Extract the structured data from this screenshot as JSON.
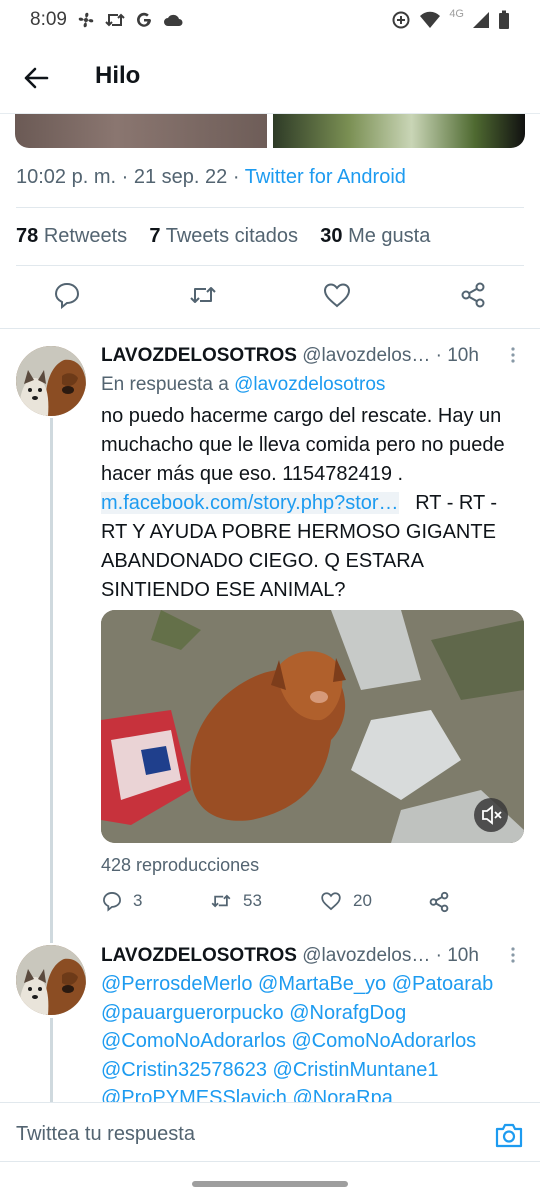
{
  "status_bar": {
    "time": "8:09",
    "network": "4G"
  },
  "header": {
    "title": "Hilo"
  },
  "main_tweet": {
    "time": "10:02 p. m.",
    "date": "21 sep. 22",
    "source": "Twitter for Android",
    "separator": "·",
    "retweets_count": "78",
    "retweets_label": "Retweets",
    "quotes_count": "7",
    "quotes_label": "Tweets citados",
    "likes_count": "30",
    "likes_label": "Me gusta"
  },
  "reply1": {
    "name": "LAVOZDELOSOTROS",
    "handle": "@lavozdelos…",
    "time": "· 10h",
    "reply_prefix": "En respuesta a",
    "reply_to": "@lavozdelosotros",
    "text_1": "no puedo hacerme cargo del rescate. Hay un muchacho que le lleva comida pero no puede hacer más que eso. 1154782419 .",
    "link": "m.facebook.com/story.php?stor…",
    "text_2": "RT - RT - RT Y AYUDA POBRE HERMOSO GIGANTE ABANDONADO CIEGO.    Q ESTARA SINTIENDO ESE ANIMAL?",
    "views": "428 reproducciones",
    "replies": "3",
    "retweets": "53",
    "likes": "20"
  },
  "reply2": {
    "name": "LAVOZDELOSOTROS",
    "handle": "@lavozdelos…",
    "time": "· 10h",
    "mentions": "@PerrosdeMerlo @MartaBe_yo @Patoarab @pauarguerorpucko @NorafgDog @ComoNoAdorarlos @ComoNoAdorarlos @Cristin32578623 @CristinMuntane1 @ProPYMESSlavich @NoraRpa"
  },
  "composer": {
    "placeholder": "Twittea tu respuesta"
  },
  "colors": {
    "accent": "#1d9bf0",
    "secondary_text": "#536471",
    "divider": "#e1e8ed"
  }
}
